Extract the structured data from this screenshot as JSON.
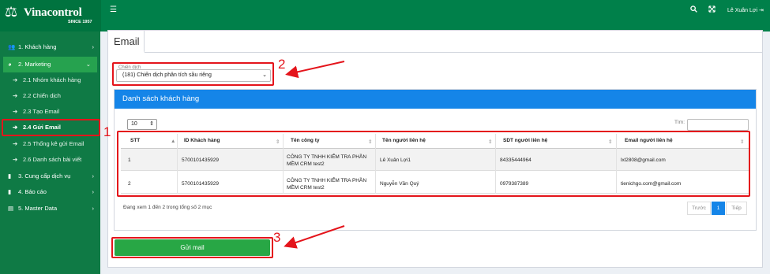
{
  "brand": {
    "name": "Vinacontrol",
    "since": "SINCE 1957"
  },
  "topbar": {
    "menu_icon": "bars-icon",
    "user_name": "Lê Xuân Lợi"
  },
  "sidebar": {
    "items": [
      {
        "label": "1. Khách hàng",
        "icon": "users-icon",
        "chevron": "›"
      },
      {
        "label": "2. Marketing",
        "icon": "globe-icon",
        "chevron": "⌄"
      },
      {
        "label": "2.1 Nhóm khách hàng",
        "icon": "arrow-icon"
      },
      {
        "label": "2.2 Chiến dịch",
        "icon": "arrow-icon"
      },
      {
        "label": "2.3 Tạo Email",
        "icon": "arrow-icon"
      },
      {
        "label": "2.4 Gửi Email",
        "icon": "arrow-icon"
      },
      {
        "label": "2.5 Thống kê gửi Email",
        "icon": "arrow-icon"
      },
      {
        "label": "2.6 Danh sách bài viết",
        "icon": "arrow-icon"
      },
      {
        "label": "3. Cung cấp dịch vụ",
        "icon": "file-icon",
        "chevron": "›"
      },
      {
        "label": "4. Báo cáo",
        "icon": "file-icon",
        "chevron": "›"
      },
      {
        "label": "5. Master Data",
        "icon": "database-icon",
        "chevron": "›"
      }
    ]
  },
  "page": {
    "tab_title": "Email"
  },
  "campaign": {
    "label": "Chiến dịch",
    "selected": "(181) Chiến dịch phân tích sầu riêng"
  },
  "customers": {
    "title": "Danh sách khách hàng",
    "page_size": "10",
    "search_label": "Tìm:",
    "columns": [
      "STT",
      "ID Khách hàng",
      "Tên công ty",
      "Tên người liên hệ",
      "SDT người liên hệ",
      "Email người liên hệ"
    ],
    "rows": [
      {
        "stt": "1",
        "id": "5700101435929",
        "company_line1": "CÔNG TY TNHH KIỂM TRA PHẦN",
        "company_line2": "MỀM CRM test2",
        "contact": "Lê Xuân Lợi1",
        "phone": "84335444964",
        "email": "lxl2808@gmail.com"
      },
      {
        "stt": "2",
        "id": "5700101435929",
        "company_line1": "CÔNG TY TNHH KIỂM TRA PHẦN",
        "company_line2": "MỀM CRM test2",
        "contact": "Nguyễn Văn Quý",
        "phone": "0979387389",
        "email": "tienichgo.com@gmail.com"
      }
    ],
    "info": "Đang xem 1 đến 2 trong tổng số 2 mục",
    "pagination": {
      "prev": "Trước",
      "current": "1",
      "next": "Tiếp"
    }
  },
  "send_button": "Gửi mail",
  "annotations": {
    "step1": "1",
    "step2": "2",
    "step3": "3"
  },
  "colors": {
    "sidebar": "#0f7a45",
    "topbar": "#00804a",
    "primary": "#1585e8",
    "success": "#28a745",
    "annotation": "#e4141b"
  }
}
